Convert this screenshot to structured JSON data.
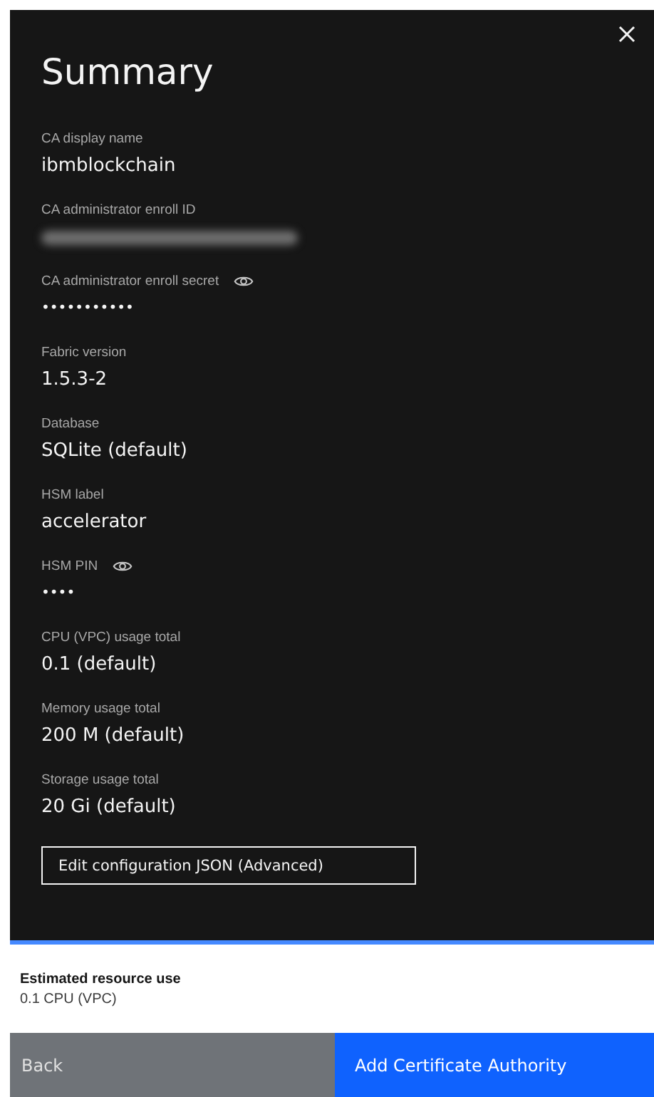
{
  "title": "Summary",
  "fields": [
    {
      "kind": "text",
      "label": "CA display name",
      "value": "ibmblockchain"
    },
    {
      "kind": "redacted",
      "label": "CA administrator enroll ID"
    },
    {
      "kind": "secret",
      "label": "CA administrator enroll secret",
      "value": "•••••••••••"
    },
    {
      "kind": "text",
      "label": "Fabric version",
      "value": "1.5.3-2"
    },
    {
      "kind": "text",
      "label": "Database",
      "value": "SQLite (default)"
    },
    {
      "kind": "text",
      "label": "HSM label",
      "value": "accelerator"
    },
    {
      "kind": "secret",
      "label": "HSM PIN",
      "value": "••••"
    },
    {
      "kind": "text",
      "label": "CPU (VPC) usage total",
      "value": "0.1 (default)"
    },
    {
      "kind": "text",
      "label": "Memory usage total",
      "value": "200 M (default)"
    },
    {
      "kind": "text",
      "label": "Storage usage total",
      "value": "20 Gi (default)"
    }
  ],
  "edit_button": "Edit configuration JSON (Advanced)",
  "estimate": {
    "title": "Estimated resource use",
    "value": "0.1 CPU (VPC)"
  },
  "buttons": {
    "back": "Back",
    "primary": "Add Certificate Authority"
  }
}
